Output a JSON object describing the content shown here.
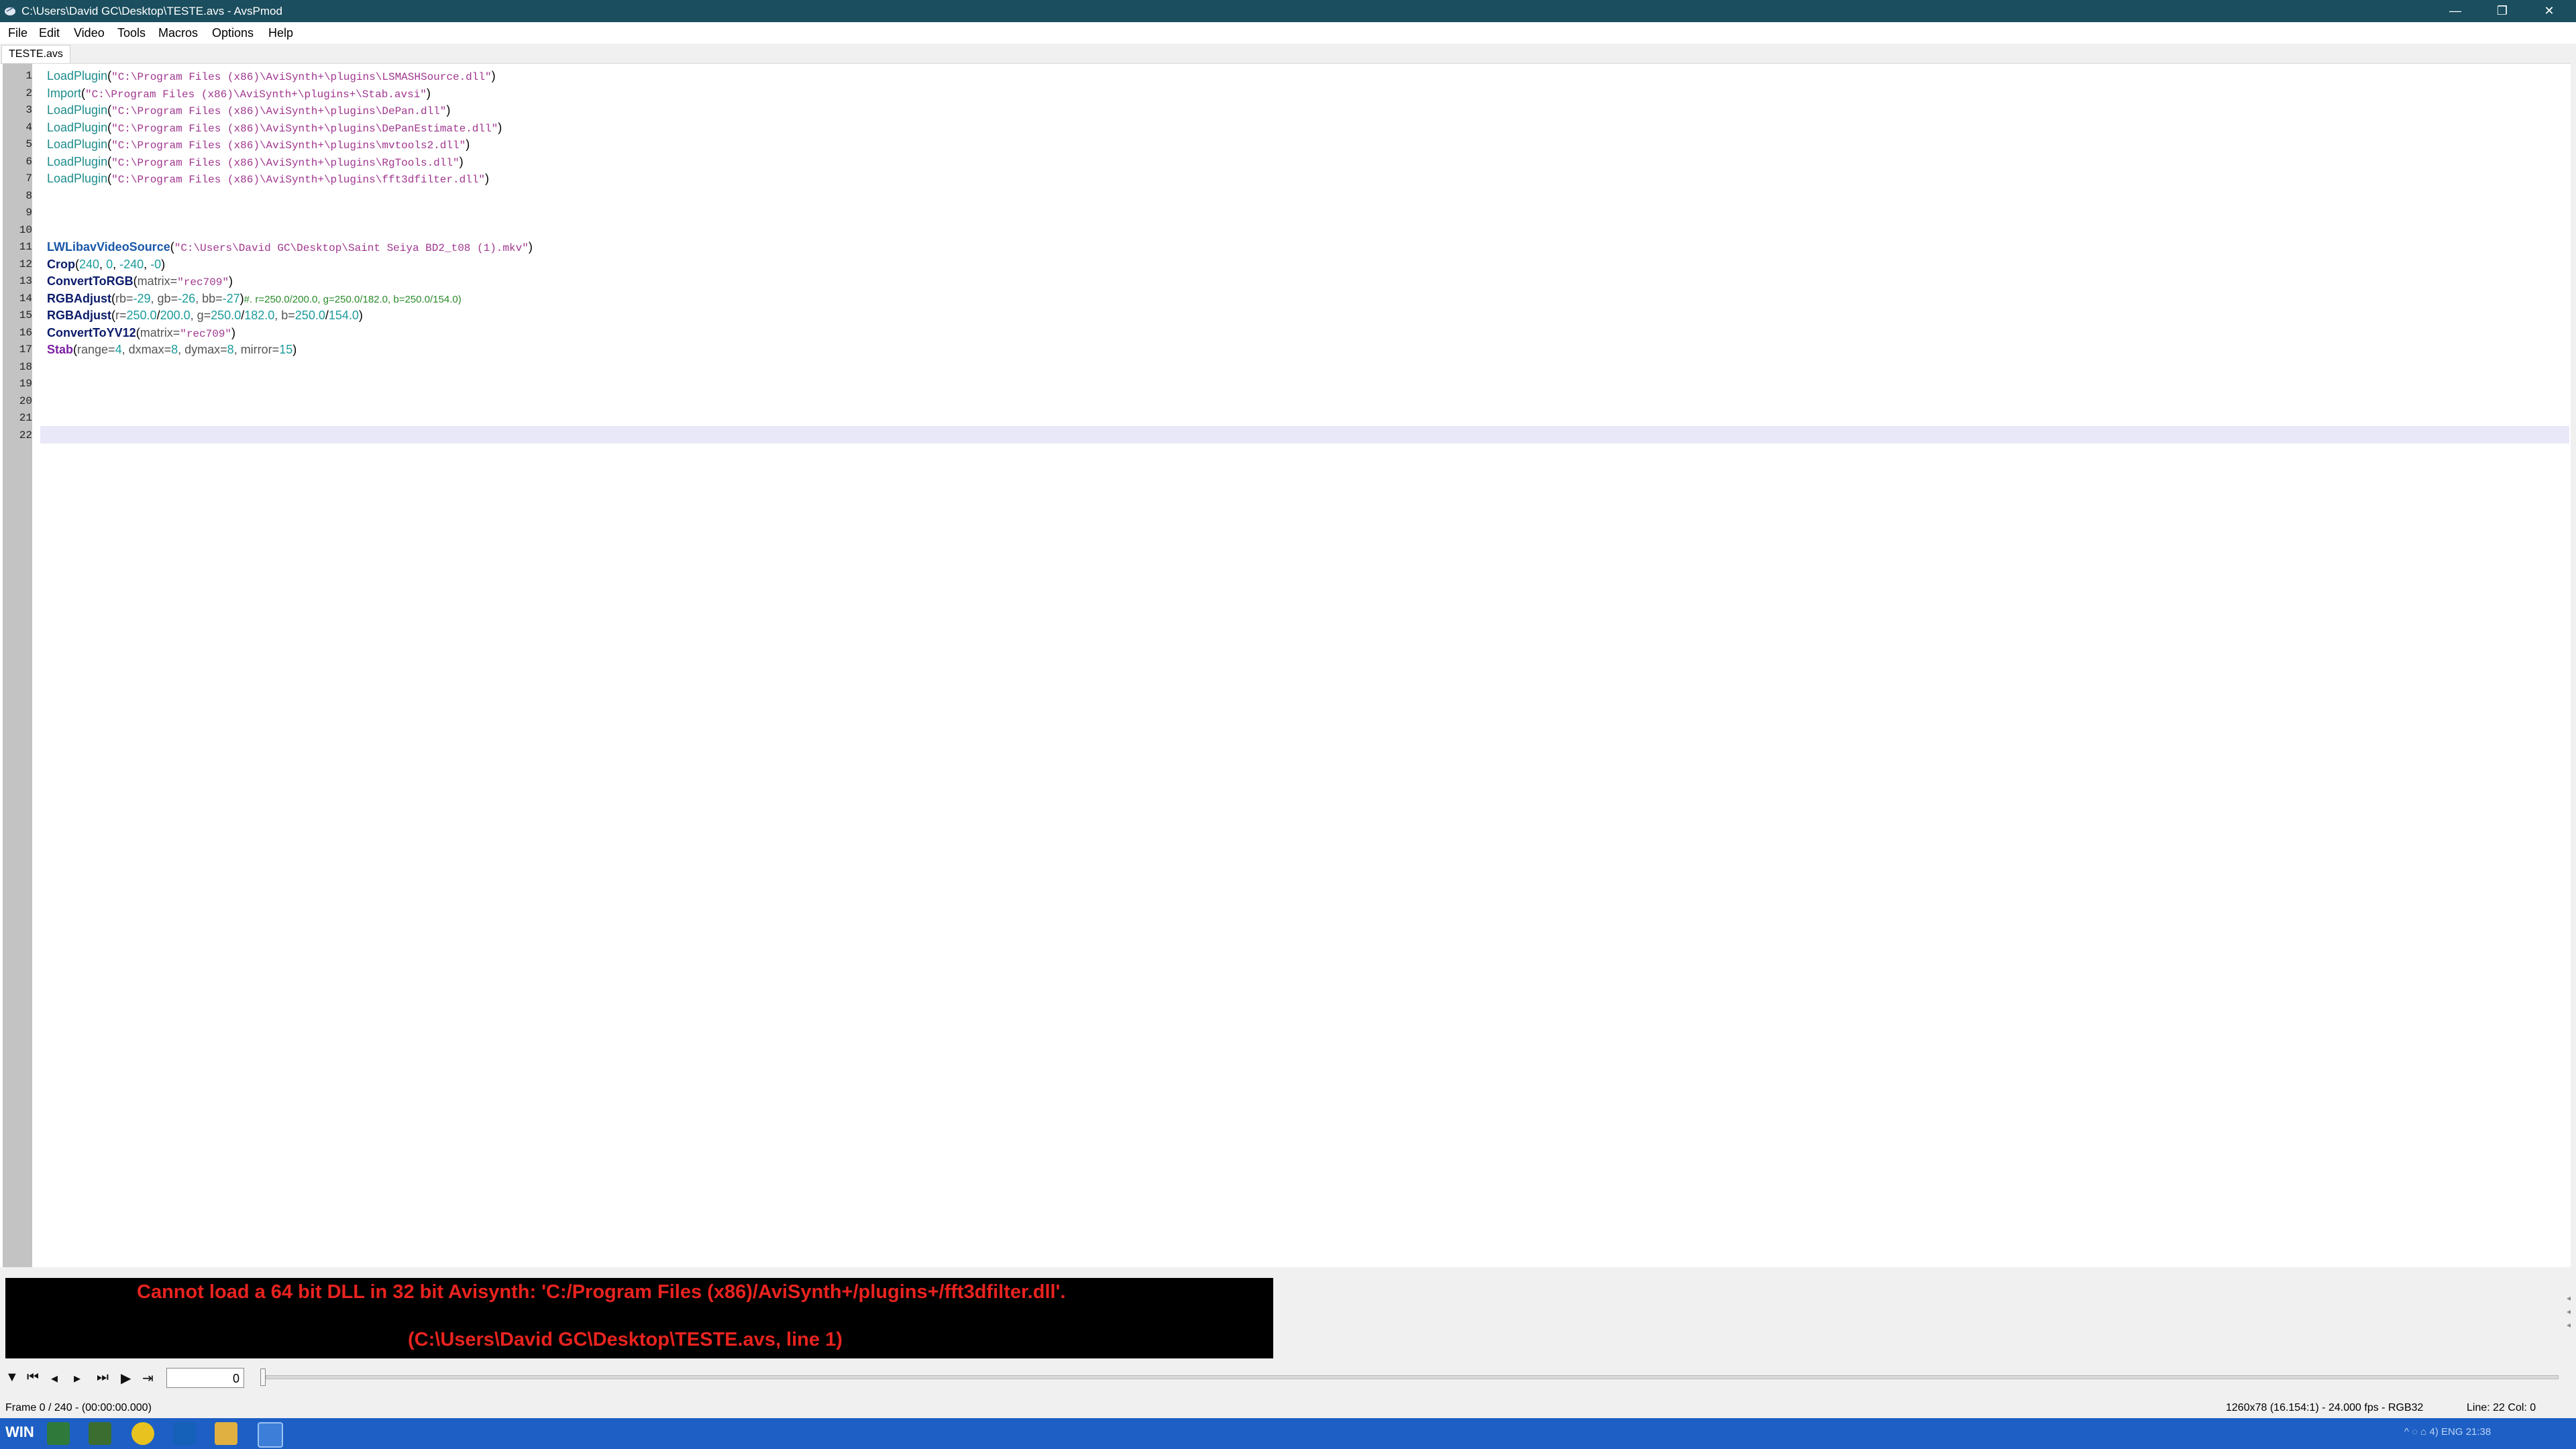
{
  "window": {
    "title": "C:\\Users\\David GC\\Desktop\\TESTE.avs - AvsPmod",
    "minimize": "—",
    "restore": "❐",
    "close": "✕"
  },
  "menu": [
    "File",
    "Edit",
    "Video",
    "Tools",
    "Macros",
    "Options",
    "Help"
  ],
  "tabs": [
    {
      "label": "TESTE.avs"
    }
  ],
  "line_numbers": [
    "1",
    "2",
    "3",
    "4",
    "5",
    "6",
    "7",
    "8",
    "9",
    "10",
    "11",
    "12",
    "13",
    "14",
    "15",
    "16",
    "17",
    "18",
    "19",
    "20",
    "21",
    "22"
  ],
  "code": {
    "l1": {
      "fn": "LoadPlugin",
      "open": "(",
      "str": "\"C:\\Program Files (x86)\\AviSynth+\\plugins\\LSMASHSource.dll\"",
      "close": ")"
    },
    "l2": {
      "fn": "Import",
      "open": "(",
      "str": "\"C:\\Program Files (x86)\\AviSynth+\\plugins+\\Stab.avsi\"",
      "close": ")"
    },
    "l3": {
      "fn": "LoadPlugin",
      "open": "(",
      "str": "\"C:\\Program Files (x86)\\AviSynth+\\plugins\\DePan.dll\"",
      "close": ")"
    },
    "l4": {
      "fn": "LoadPlugin",
      "open": "(",
      "str": "\"C:\\Program Files (x86)\\AviSynth+\\plugins\\DePanEstimate.dll\"",
      "close": ")"
    },
    "l5": {
      "fn": "LoadPlugin",
      "open": "(",
      "str": "\"C:\\Program Files (x86)\\AviSynth+\\plugins\\mvtools2.dll\"",
      "close": ")"
    },
    "l6": {
      "fn": "LoadPlugin",
      "open": "(",
      "str": "\"C:\\Program Files (x86)\\AviSynth+\\plugins\\RgTools.dll\"",
      "close": ")"
    },
    "l7": {
      "fn": "LoadPlugin",
      "open": "(",
      "str": "\"C:\\Program Files (x86)\\AviSynth+\\plugins\\fft3dfilter.dll\"",
      "close": ")"
    },
    "l11": {
      "fn": "LWLibavVideoSource",
      "open": "(",
      "str": "\"C:\\Users\\David GC\\Desktop\\Saint Seiya BD2_t08 (1).mkv\"",
      "close": ")"
    },
    "l12": {
      "fn": "Crop",
      "open": "(",
      "a": "240",
      "c1": ", ",
      "b": "0",
      "c2": ", ",
      "c": "-240",
      "c3": ", ",
      "d": "-0",
      "close": ")"
    },
    "l13": {
      "fn": "ConvertToRGB",
      "open": "(",
      "p": "matrix=",
      "str": "\"rec709\"",
      "close": ")"
    },
    "l14": {
      "fn": "RGBAdjust",
      "open": "(",
      "p1": "rb=",
      "v1": "-29",
      "p2": ", gb=",
      "v2": "-26",
      "p3": ", bb=",
      "v3": "-27",
      "close": ")",
      "comment": "#. r=250.0/200.0, g=250.0/182.0, b=250.0/154.0)"
    },
    "l15": {
      "fn": "RGBAdjust",
      "open": "(",
      "p1": "r=",
      "v1": "250.0",
      "s1": "/",
      "v2": "200.0",
      "p2": ", g=",
      "v3": "250.0",
      "s2": "/",
      "v4": "182.0",
      "p3": ", b=",
      "v5": "250.0",
      "s3": "/",
      "v6": "154.0",
      "close": ")"
    },
    "l16": {
      "fn": "ConvertToYV12",
      "open": "(",
      "p": "matrix=",
      "str": "\"rec709\"",
      "close": ")"
    },
    "l17": {
      "fn": "Stab",
      "open": "(",
      "p1": "range=",
      "v1": "4",
      "p2": ", dxmax=",
      "v2": "8",
      "p3": ", dymax=",
      "v3": "8",
      "p4": ", mirror=",
      "v4": "15",
      "close": ")"
    }
  },
  "error": {
    "line1": "Cannot load a 64 bit DLL in 32 bit Avisynth: 'C:/Program Files (x86)/AviSynth+/plugins+/fft3dfilter.dll'.",
    "line2": "(C:\\Users\\David GC\\Desktop\\TESTE.avs, line 1)"
  },
  "playback": {
    "frame_value": "0"
  },
  "status": {
    "left": "Frame 0 / 240  -  (00:00:00.000)",
    "right": "1260x78 (16.154:1)  -  24.000 fps  -  RGB32",
    "line_col": "Line: 22  Col: 0"
  },
  "taskbar": {
    "start": "WIN",
    "tray": "^  ◌  ⌂  4)  ENG  21:38"
  },
  "colors": {
    "titlebar": "#1b4e5e",
    "error_text": "#e8231f",
    "taskbar": "#1d5fc4"
  }
}
